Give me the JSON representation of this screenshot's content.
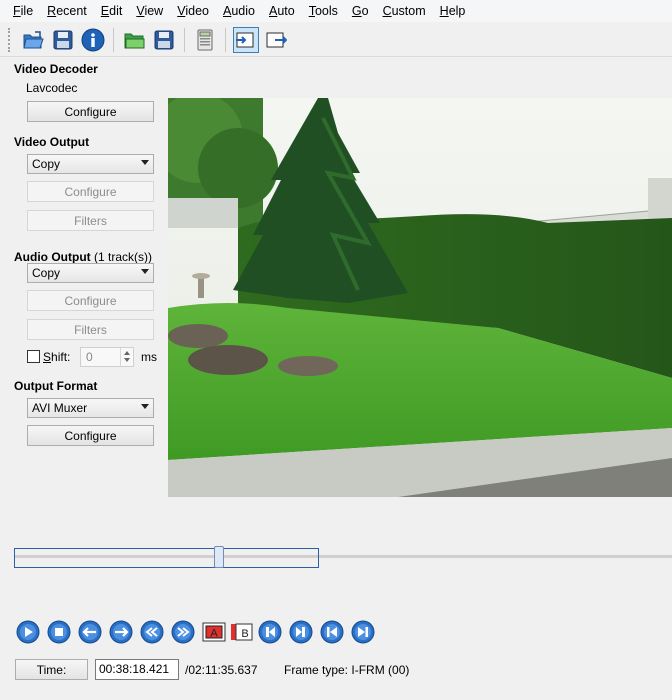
{
  "menu": [
    "File",
    "Recent",
    "Edit",
    "View",
    "Video",
    "Audio",
    "Auto",
    "Tools",
    "Go",
    "Custom",
    "Help"
  ],
  "toolbar": {
    "icons": [
      "open-video-icon",
      "save-video-icon",
      "info-icon",
      "open-folder-icon",
      "save-icon",
      "calculator-icon",
      "input-view-icon",
      "output-view-icon"
    ]
  },
  "video_decoder": {
    "title": "Video Decoder",
    "codec": "Lavcodec",
    "configure": "Configure"
  },
  "video_output": {
    "title": "Video Output",
    "selected": "Copy",
    "configure": "Configure",
    "filters": "Filters"
  },
  "audio_output": {
    "title": "Audio Output",
    "tracks": "(1 track(s))",
    "selected": "Copy",
    "configure": "Configure",
    "filters": "Filters",
    "shift_label": "Shift:",
    "shift_value": "0",
    "shift_unit": "ms"
  },
  "output_format": {
    "title": "Output Format",
    "selected": "AVI Muxer",
    "configure": "Configure"
  },
  "slider": {
    "position_fraction": 0.33
  },
  "transport": {
    "marker_a": "A",
    "marker_b": "B"
  },
  "status": {
    "time_button": "Time:",
    "current_time": "00:38:18.421",
    "total_time": "/02:11:35.637",
    "frame_type_label": "Frame type:",
    "frame_type": "I-FRM (00)"
  },
  "colors": {
    "accent_blue": "#2d5ea8",
    "marker_red": "#e03030"
  }
}
